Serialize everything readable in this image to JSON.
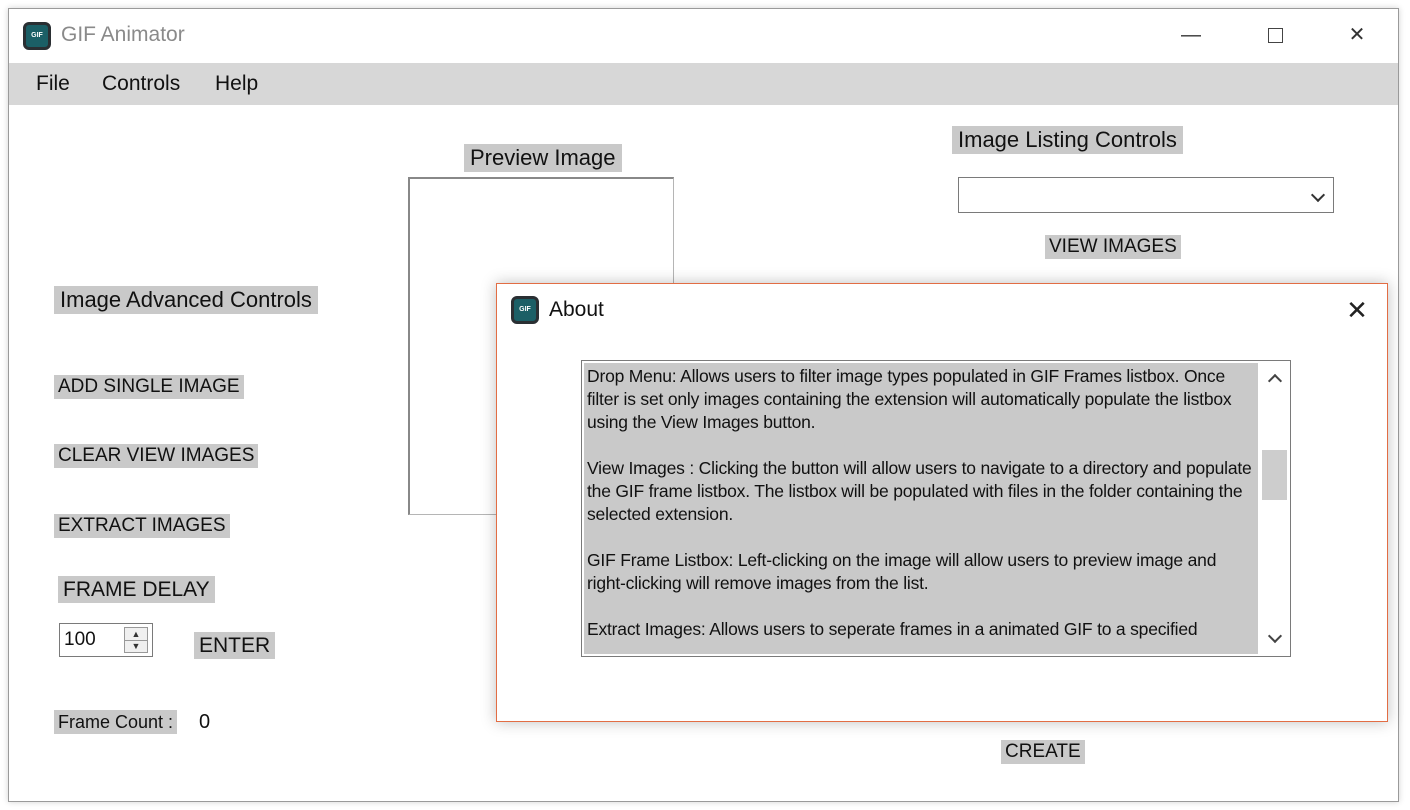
{
  "window": {
    "title": "GIF Animator",
    "icon_text": "GIF",
    "controls": {
      "minimize": "—",
      "close": "✕"
    }
  },
  "menu": {
    "items": [
      "File",
      "Controls",
      "Help"
    ]
  },
  "main": {
    "preview_label": "Preview Image",
    "listing_controls_label": "Image Listing Controls",
    "extension_dropdown_value": "",
    "view_images_button": "VIEW IMAGES",
    "advanced_controls_label": "Image Advanced Controls",
    "add_single_image_button": "ADD SINGLE IMAGE",
    "clear_view_images_button": "CLEAR VIEW IMAGES",
    "extract_images_button": "EXTRACT IMAGES",
    "frame_delay_label": "FRAME DELAY",
    "frame_delay_value": "100",
    "enter_button": "ENTER",
    "frame_count_label": "Frame Count :",
    "frame_count_value": "0",
    "create_button": "CREATE"
  },
  "about_dialog": {
    "title": "About",
    "icon_text": "GIF",
    "close": "✕",
    "paragraphs": [
      "Drop Menu: Allows users to filter image types populated in GIF Frames listbox. Once filter is set only images containing the extension will automatically populate the listbox using the View Images button.",
      "View Images : Clicking the button will allow users to navigate to a directory and populate the GIF frame listbox. The listbox will be populated with files in the folder containing the selected extension.",
      "GIF Frame Listbox: Left-clicking on the image will allow users to preview image and right-clicking will remove images from the list.",
      "Extract Images: Allows users to seperate frames in a animated GIF to a specified"
    ]
  },
  "colors": {
    "menubar": "#d7d7d7",
    "label_bg": "#c9c9c9",
    "dialog_border": "#e26d44",
    "icon_bg": "#1b5f66"
  }
}
